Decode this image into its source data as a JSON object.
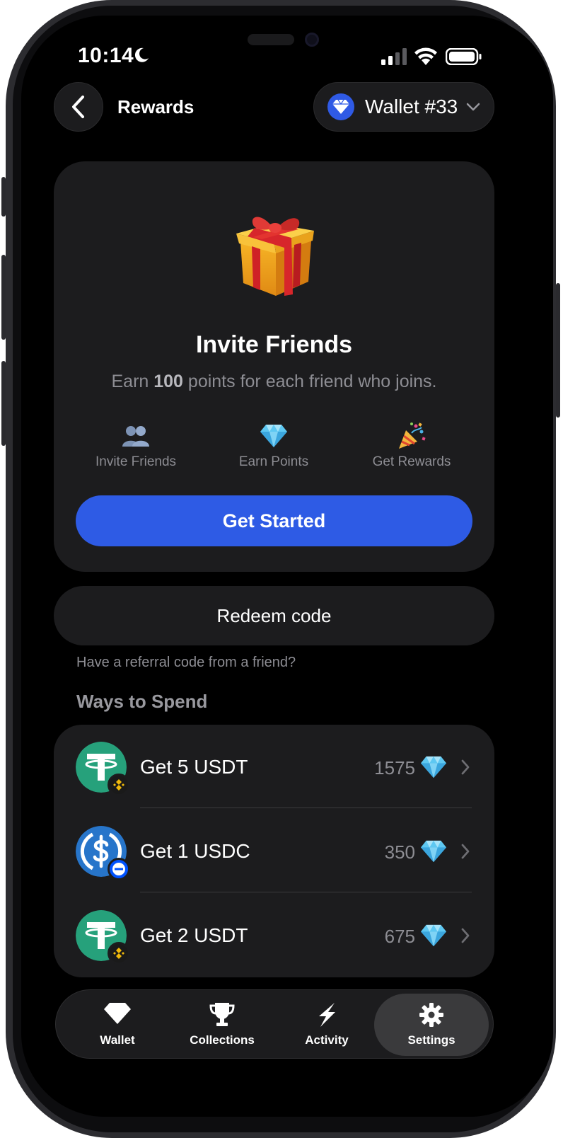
{
  "status_bar": {
    "time": "10:14"
  },
  "header": {
    "title": "Rewards",
    "wallet_label": "Wallet #33"
  },
  "invite": {
    "title": "Invite Friends",
    "subtitle_pre": "Earn ",
    "subtitle_points": "100",
    "subtitle_post": " points for each friend who joins.",
    "steps": [
      {
        "label": "Invite Friends",
        "icon": "people-icon"
      },
      {
        "label": "Earn Points",
        "icon": "gem-icon"
      },
      {
        "label": "Get Rewards",
        "icon": "party-popper-icon"
      }
    ],
    "cta_label": "Get Started"
  },
  "redeem": {
    "label": "Redeem code",
    "hint": "Have a referral code from a friend?"
  },
  "ways_to_spend": {
    "title": "Ways to Spend",
    "items": [
      {
        "label": "Get 5 USDT",
        "cost": "1575",
        "token": "tether-icon",
        "chain": "bnb-chain-icon",
        "color": "#26a17b"
      },
      {
        "label": "Get 1 USDC",
        "cost": "350",
        "token": "usdc-icon",
        "chain": "base-chain-icon",
        "color": "#2775ca"
      },
      {
        "label": "Get 2 USDT",
        "cost": "675",
        "token": "tether-icon",
        "chain": "bnb-chain-icon",
        "color": "#26a17b"
      }
    ]
  },
  "tabs": [
    {
      "label": "Wallet",
      "icon": "gem-icon"
    },
    {
      "label": "Collections",
      "icon": "trophy-icon"
    },
    {
      "label": "Activity",
      "icon": "lightning-icon"
    },
    {
      "label": "Settings",
      "icon": "gear-icon",
      "active": true
    }
  ],
  "colors": {
    "accent": "#2e5be5",
    "card": "#1c1c1e",
    "background": "#000000"
  }
}
